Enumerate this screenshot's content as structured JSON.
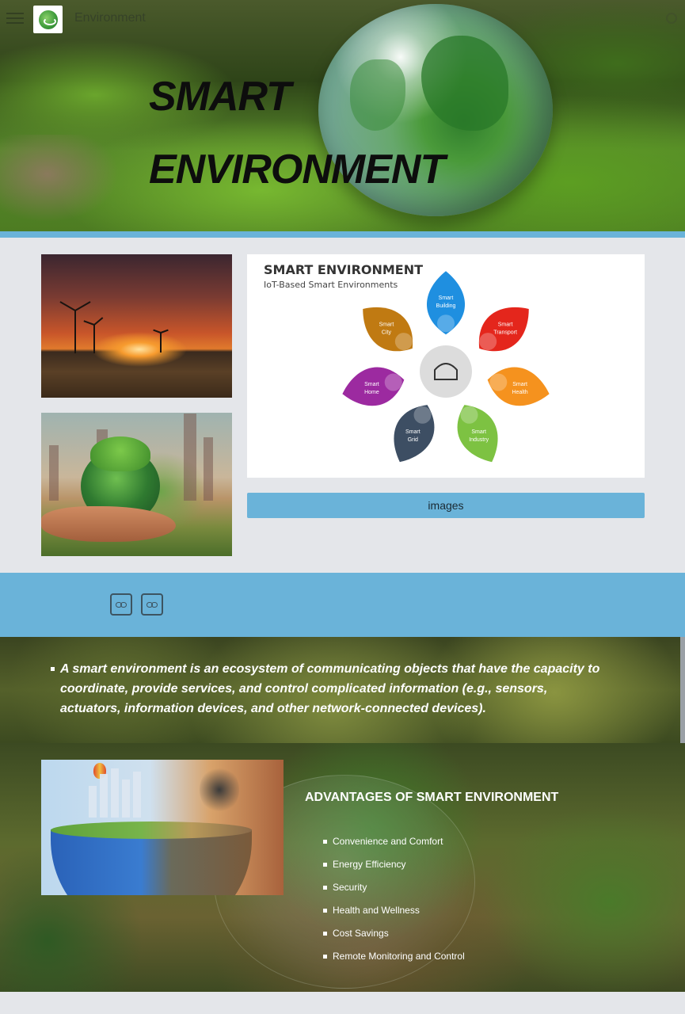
{
  "header": {
    "site_title": "Environment",
    "menu_icon": "hamburger-menu-icon",
    "search_icon": "search-icon"
  },
  "hero": {
    "title_line1": "SMART",
    "title_line2": "ENVIRONMENT"
  },
  "diagram": {
    "title": "SMART ENVIRONMENT",
    "subtitle": "IoT-Based Smart Environments",
    "petals": [
      {
        "line1": "Smart",
        "line2": "Building",
        "color": "#1f8fe0"
      },
      {
        "line1": "Smart",
        "line2": "Transport",
        "color": "#e4261c"
      },
      {
        "line1": "Smart",
        "line2": "Health",
        "color": "#f5921e"
      },
      {
        "line1": "Smart",
        "line2": "Industry",
        "color": "#7dc242"
      },
      {
        "line1": "Smart",
        "line2": "Grid",
        "color": "#3d4e63"
      },
      {
        "line1": "Smart",
        "line2": "Home",
        "color": "#9c2aa0"
      },
      {
        "line1": "Smart",
        "line2": "City",
        "color": "#c07a12"
      }
    ]
  },
  "gallery": {
    "images_label": "images"
  },
  "links": {
    "icon": "link-icon"
  },
  "definition": {
    "text": "A smart environment is an ecosystem of communicating objects that have the capacity to coordinate, provide services, and control complicated information (e.g., sensors, actuators, information devices, and other network-connected devices)."
  },
  "advantages": {
    "title": "ADVANTAGES OF SMART ENVIRONMENT",
    "items": [
      "Convenience and Comfort",
      "Energy Efficiency",
      "Security",
      "Health and Wellness",
      "Cost Savings",
      "Remote Monitoring and Control"
    ]
  }
}
